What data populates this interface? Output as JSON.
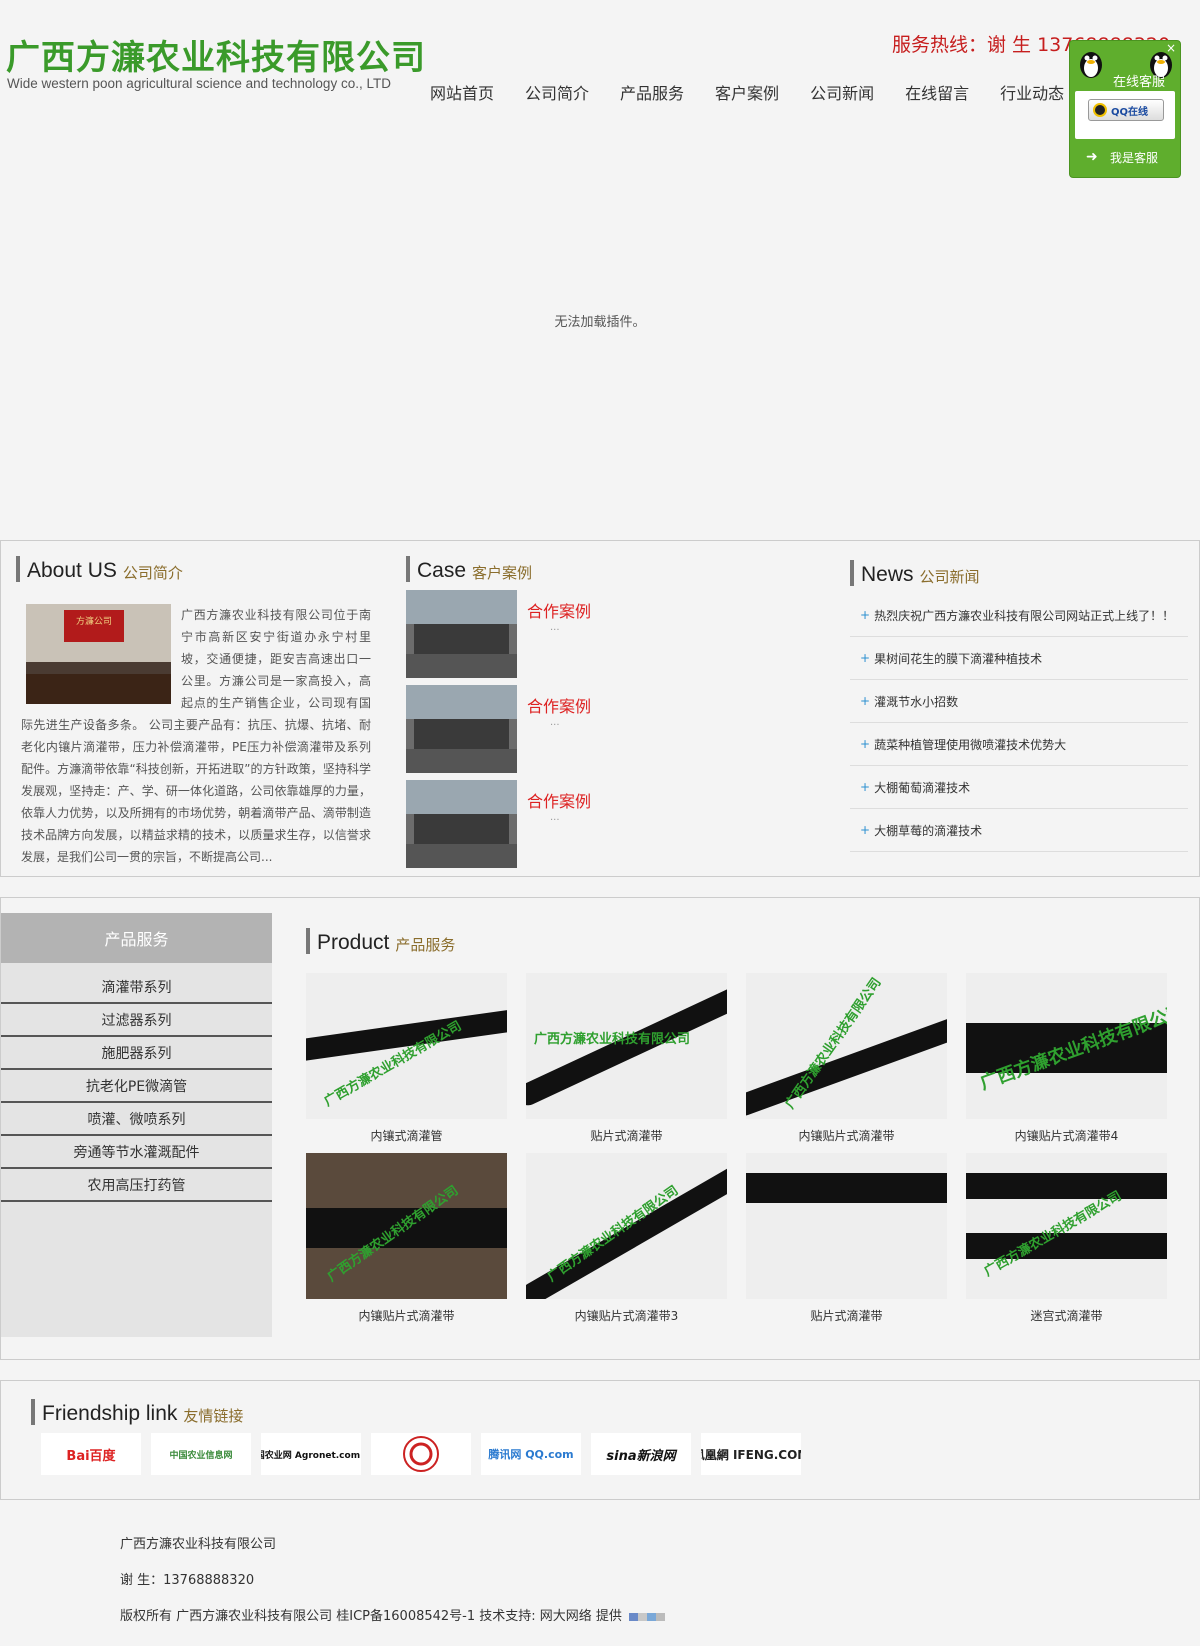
{
  "header": {
    "logo_cn": "广西方濂农业科技有限公司",
    "logo_en": "Wide western poon agricultural science and technology co., LTD",
    "hotline": "服务热线：谢 生 13768888320"
  },
  "nav": [
    "网站首页",
    "公司简介",
    "产品服务",
    "客户案例",
    "公司新闻",
    "在线留言",
    "行业动态"
  ],
  "service": {
    "title": "在线客服",
    "qq_label": "QQ在线",
    "me_label": "我是客服",
    "close": "×"
  },
  "banner": {
    "plugin_message": "无法加载插件。"
  },
  "about": {
    "title_en": "About US",
    "title_cn": "公司简介",
    "plaque": "方濂公司",
    "text": "广西方濂农业科技有限公司位于南宁市高新区安宁街道办永宁村里坡，交通便捷，距安吉高速出口一公里。方濂公司是一家高投入，高起点的生产销售企业，公司现有国际先进生产设备多条。 公司主要产品有：抗压、抗爆、抗堵、耐老化内镶片滴灌带，压力补偿滴灌带，PE压力补偿滴灌带及系列配件。方濂滴带依靠“科技创新，开拓进取”的方针政策，坚持科学发展观，坚持走：产、学、研一体化道路，公司依靠雄厚的力量，依靠人力优势，以及所拥有的市场优势，朝着滴带产品、滴带制造技术品牌方向发展，以精益求精的技术，以质量求生存，以信誉求发展，是我们公司一贯的宗旨，不断提高公司..."
  },
  "case": {
    "title_en": "Case",
    "title_cn": "客户案例",
    "items": [
      {
        "title": "合作案例",
        "desc": "..."
      },
      {
        "title": "合作案例",
        "desc": "..."
      },
      {
        "title": "合作案例",
        "desc": "..."
      }
    ]
  },
  "news": {
    "title_en": "News",
    "title_cn": "公司新闻",
    "items": [
      "热烈庆祝广西方濂农业科技有限公司网站正式上线了！！",
      "果树间花生的膜下滴灌种植技术",
      "灌溉节水小招数",
      "蔬菜种植管理使用微喷灌技术优势大",
      "大棚葡萄滴灌技术",
      "大棚草莓的滴灌技术"
    ]
  },
  "sidebar": {
    "heading": "产品服务",
    "items": [
      "滴灌带系列",
      "过滤器系列",
      "施肥器系列",
      "抗老化PE微滴管",
      "喷灌、微喷系列",
      "旁通等节水灌溉配件",
      "农用高压打药管"
    ]
  },
  "product": {
    "title_en": "Product",
    "title_cn": "产品服务",
    "watermark": "广西方濂农业科技有限公司",
    "items": [
      "内镶式滴灌管",
      "贴片式滴灌带",
      "内镶贴片式滴灌带",
      "内镶贴片式滴灌带4",
      "内镶贴片式滴灌带",
      "内镶贴片式滴灌带3",
      "贴片式滴灌带",
      "迷宫式滴灌带"
    ]
  },
  "links": {
    "title_en": "Friendship link",
    "title_cn": "友情链接",
    "items": [
      "Bai百度",
      "中国农业信息网",
      "中国农业网 Agronet.com.cn",
      "",
      "腾讯网 QQ.com",
      "sina新浪网",
      "凤凰網 IFENG.COM"
    ]
  },
  "footer": {
    "company": "广西方濂农业科技有限公司",
    "contact": "谢 生：13768888320",
    "copyright": "版权所有   广西方濂农业科技有限公司 桂ICP备16008542号-1 技术支持: 网大网络 提供"
  },
  "colors": {
    "logo_green": "#3a9a2a",
    "hotline_red": "#c61e1e",
    "case_red": "#dd2222",
    "service_green": "#5fae2d",
    "sidebar_head": "#b3b3b3",
    "title_cn_brown": "#8a6d2c"
  }
}
